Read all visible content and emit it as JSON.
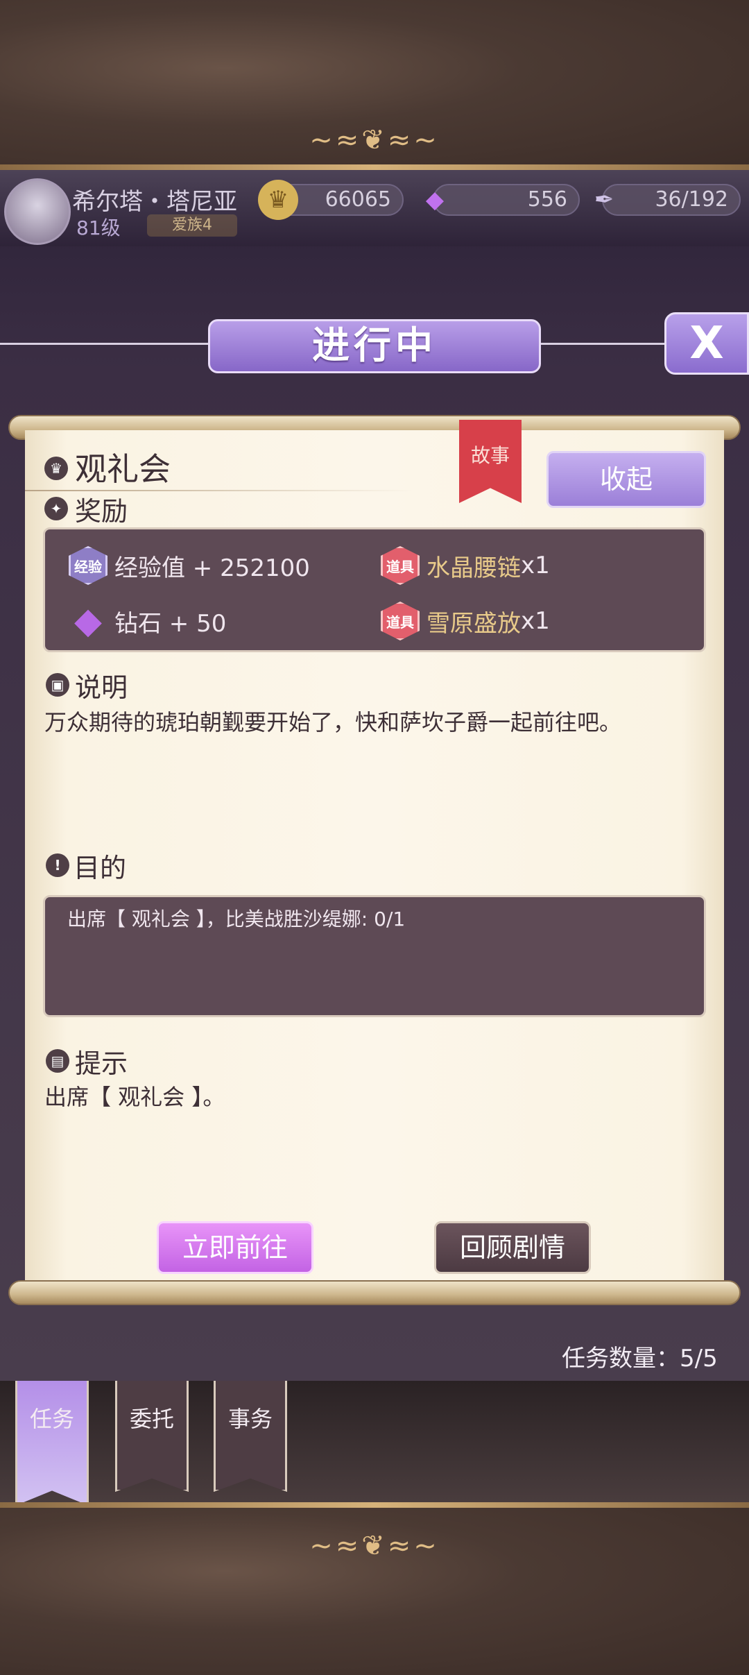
{
  "player": {
    "name": "希尔塔・塔尼亚",
    "level": "81级",
    "badge": "爱族4"
  },
  "resources": {
    "gold": "66065",
    "gems": "556",
    "stamina": "36/192"
  },
  "header": {
    "title": "进行中",
    "close": "X"
  },
  "quest": {
    "title": "观礼会",
    "tag": "故事",
    "collapse_label": "收起",
    "rewards_title": "奖励",
    "rewards": [
      {
        "icon_label": "经验",
        "text": "经验值 + 252100"
      },
      {
        "icon_label": "道具",
        "text": "水晶腰链",
        "qty": "x1"
      },
      {
        "icon_label": "",
        "text": "钻石 + 50"
      },
      {
        "icon_label": "道具",
        "text": "雪原盛放",
        "qty": "x1"
      }
    ],
    "description_title": "说明",
    "description": "万众期待的琥珀朝觐要开始了，快和萨坎子爵一起前往吧。",
    "objective_title": "目的",
    "objective": "出席【 观礼会 】，比美战胜沙缇娜: 0/1",
    "hint_title": "提示",
    "hint": "出席【 观礼会 】。",
    "go_button": "立即前往",
    "review_button": "回顾剧情"
  },
  "task_count": "任务数量：5/5",
  "tabs": [
    "任务",
    "委托",
    "事务"
  ]
}
